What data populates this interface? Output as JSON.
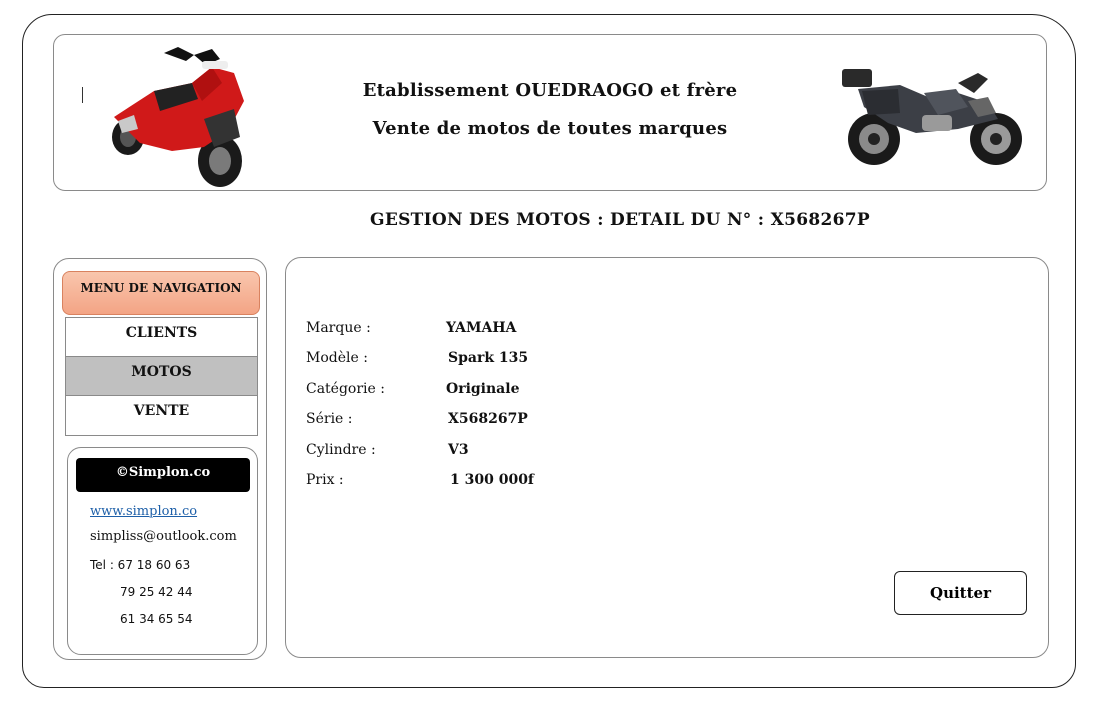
{
  "header": {
    "title": "Etablissement OUEDRAOGO et frère",
    "subtitle": "Vente de motos de toutes marques"
  },
  "page_heading": "GESTION DES MOTOS : DETAIL DU N° : X568267P",
  "nav": {
    "title": "MENU DE NAVIGATION",
    "items": [
      {
        "label": "CLIENTS"
      },
      {
        "label": "MOTOS"
      },
      {
        "label": "VENTE"
      }
    ],
    "active_color": "#c0c0c0"
  },
  "contact": {
    "brand": "©Simplon.co",
    "website": "www.simplon.co",
    "email": "simpliss@outlook.com",
    "tel_1": "Tel : 67 18 60 63",
    "tel_2": "79 25 42 44",
    "tel_3": "61 34 65 54"
  },
  "detail": {
    "fields": [
      {
        "label": "Marque :",
        "value": "YAMAHA"
      },
      {
        "label": "Modèle :",
        "value": "Spark 135"
      },
      {
        "label": "Catégorie :",
        "value": "Originale"
      },
      {
        "label": "Série :",
        "value": "X568267P"
      },
      {
        "label": "Cylindre :",
        "value": "V3"
      },
      {
        "label": "Prix :",
        "value": "1 300 000f"
      }
    ]
  },
  "actions": {
    "quit_label": "Quitter"
  },
  "icons": {
    "left_image": "scooter-icon",
    "right_image": "adventure-motorcycle-icon"
  },
  "colors": {
    "nav_header_start": "#f9c6ad",
    "nav_header_end": "#f3a485",
    "link": "#1d5fa8",
    "brand_bg": "#000000"
  }
}
